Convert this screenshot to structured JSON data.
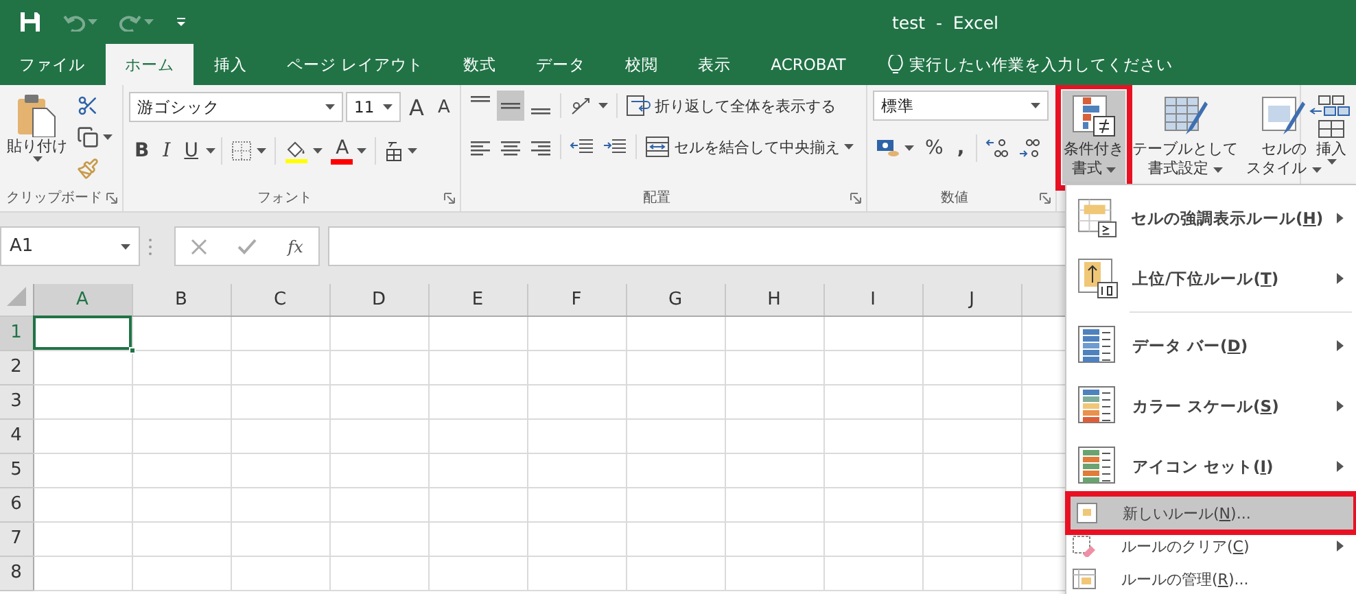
{
  "window": {
    "title": "test  -  Excel"
  },
  "quick_access": {
    "undo": {
      "disabled": true
    },
    "redo": {
      "disabled": true
    }
  },
  "tabs": [
    {
      "label": "ファイル",
      "selected": false
    },
    {
      "label": "ホーム",
      "selected": true
    },
    {
      "label": "挿入",
      "selected": false
    },
    {
      "label": "ページ レイアウト",
      "selected": false
    },
    {
      "label": "数式",
      "selected": false
    },
    {
      "label": "データ",
      "selected": false
    },
    {
      "label": "校閲",
      "selected": false
    },
    {
      "label": "表示",
      "selected": false
    },
    {
      "label": "ACROBAT",
      "selected": false
    }
  ],
  "tell_me": {
    "placeholder": "実行したい作業を入力してください"
  },
  "ribbon": {
    "clipboard": {
      "paste": "貼り付け",
      "label": "クリップボード"
    },
    "font": {
      "name": "游ゴシック",
      "size": "11",
      "grow": "A",
      "shrink": "A",
      "bold": "B",
      "italic": "I",
      "underline": "U",
      "font_color": "A",
      "label": "フォント"
    },
    "alignment": {
      "vertical": [
        {
          "selected": false
        },
        {
          "selected": true
        },
        {
          "selected": false
        }
      ],
      "wrap": "折り返して全体を表示する",
      "merge": "セルを結合して中央揃え",
      "label": "配置"
    },
    "number": {
      "format": "標準",
      "percent": "%",
      "comma": ",",
      "label": "数値"
    },
    "styles": [
      {
        "lines": [
          "条件付き",
          "書式"
        ],
        "selected": true,
        "highlighted": true
      },
      {
        "lines": [
          "テーブルとして",
          "書式設定"
        ],
        "selected": false,
        "highlighted": false
      },
      {
        "lines": [
          "セルの",
          "スタイル"
        ],
        "selected": false,
        "highlighted": false
      }
    ],
    "cells": {
      "insert": "挿入"
    }
  },
  "formula_bar": {
    "name_box": "A1",
    "function": "fx"
  },
  "sheet": {
    "columns": [
      {
        "label": "A",
        "selected": true
      },
      {
        "label": "B",
        "selected": false
      },
      {
        "label": "C",
        "selected": false
      },
      {
        "label": "D",
        "selected": false
      },
      {
        "label": "E",
        "selected": false
      },
      {
        "label": "F",
        "selected": false
      },
      {
        "label": "G",
        "selected": false
      },
      {
        "label": "H",
        "selected": false
      },
      {
        "label": "I",
        "selected": false
      },
      {
        "label": "J",
        "selected": false
      }
    ],
    "rows": [
      {
        "label": "1",
        "selected": true
      },
      {
        "label": "2",
        "selected": false
      },
      {
        "label": "3",
        "selected": false
      },
      {
        "label": "4",
        "selected": false
      },
      {
        "label": "5",
        "selected": false
      },
      {
        "label": "6",
        "selected": false
      },
      {
        "label": "7",
        "selected": false
      },
      {
        "label": "8",
        "selected": false
      }
    ]
  },
  "menu": {
    "items": [
      {
        "kind": "large",
        "before": "セルの強調表示ルール(",
        "key": "H",
        "after": ")",
        "submenu": true,
        "selected": false,
        "highlighted": false
      },
      {
        "kind": "large",
        "before": "上位/下位ルール(",
        "key": "T",
        "after": ")",
        "submenu": true,
        "selected": false,
        "highlighted": false
      },
      {
        "kind": "separator"
      },
      {
        "kind": "large",
        "before": "データ バー(",
        "key": "D",
        "after": ")",
        "submenu": true,
        "selected": false,
        "highlighted": false
      },
      {
        "kind": "large",
        "before": "カラー スケール(",
        "key": "S",
        "after": ")",
        "submenu": true,
        "selected": false,
        "highlighted": false
      },
      {
        "kind": "large",
        "before": "アイコン セット(",
        "key": "I",
        "after": ")",
        "submenu": true,
        "selected": false,
        "highlighted": false
      },
      {
        "kind": "small",
        "before": "新しいルール(",
        "key": "N",
        "after": ")...",
        "submenu": false,
        "selected": true,
        "highlighted": true
      },
      {
        "kind": "small",
        "before": "ルールのクリア(",
        "key": "C",
        "after": ")",
        "submenu": true,
        "selected": false,
        "highlighted": false
      },
      {
        "kind": "small",
        "before": "ルールの管理(",
        "key": "R",
        "after": ")...",
        "submenu": false,
        "selected": false,
        "highlighted": false
      }
    ]
  }
}
